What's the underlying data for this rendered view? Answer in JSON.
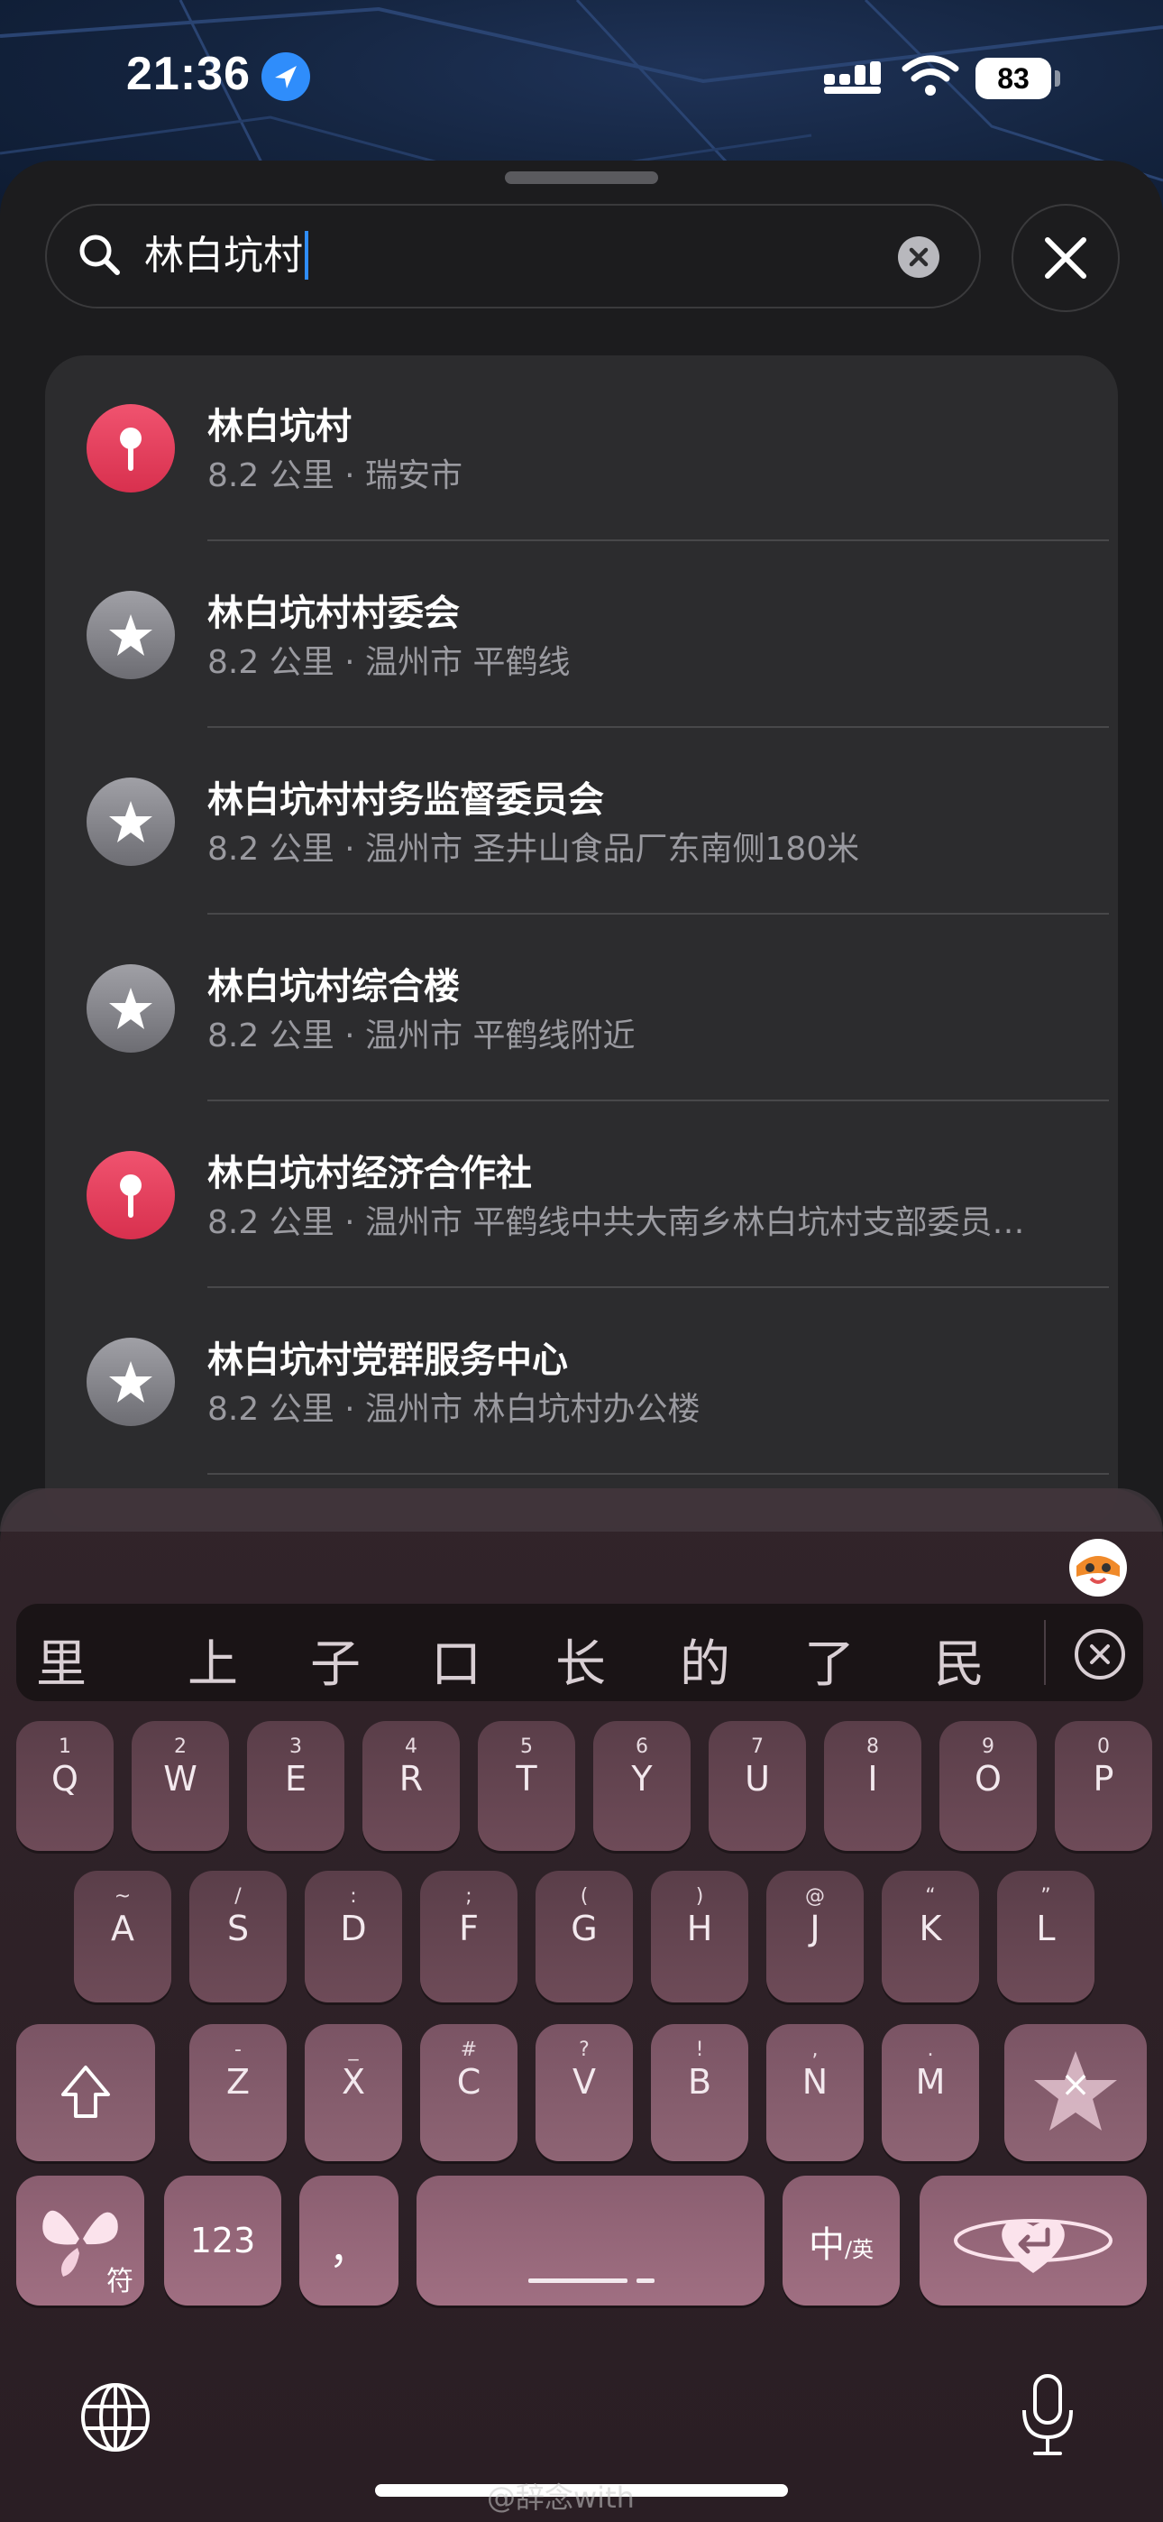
{
  "status_bar": {
    "time": "21:36",
    "battery": "83",
    "icons": [
      "location-arrow-icon",
      "cellular-signal-icon",
      "wifi-icon",
      "battery-icon"
    ]
  },
  "search": {
    "value": "林白坑村",
    "icons": [
      "search-icon",
      "clear-icon",
      "close-icon"
    ]
  },
  "results": [
    {
      "icon": "pin-icon",
      "title": "林白坑村",
      "subtitle": "8.2 公里 · 瑞安市"
    },
    {
      "icon": "star-icon",
      "title": "林白坑村村委会",
      "subtitle": "8.2 公里 · 温州市 平鹤线"
    },
    {
      "icon": "star-icon",
      "title": "林白坑村村务监督委员会",
      "subtitle": "8.2 公里 · 温州市 圣井山食品厂东南侧180米"
    },
    {
      "icon": "star-icon",
      "title": "林白坑村综合楼",
      "subtitle": "8.2 公里 · 温州市 平鹤线附近"
    },
    {
      "icon": "pin-icon",
      "title": "林白坑村经济合作社",
      "subtitle": "8.2 公里 · 温州市 平鹤线中共大南乡林白坑村支部委员…"
    },
    {
      "icon": "star-icon",
      "title": "林白坑村党群服务中心",
      "subtitle": "8.2 公里 · 温州市 林白坑村办公楼"
    }
  ],
  "keyboard": {
    "candidates": [
      "里",
      "上",
      "子",
      "口",
      "长",
      "的",
      "了",
      "民"
    ],
    "row1": [
      {
        "main": "Q",
        "sub": "1"
      },
      {
        "main": "W",
        "sub": "2"
      },
      {
        "main": "E",
        "sub": "3"
      },
      {
        "main": "R",
        "sub": "4"
      },
      {
        "main": "T",
        "sub": "5"
      },
      {
        "main": "Y",
        "sub": "6"
      },
      {
        "main": "U",
        "sub": "7"
      },
      {
        "main": "I",
        "sub": "8"
      },
      {
        "main": "O",
        "sub": "9"
      },
      {
        "main": "P",
        "sub": "0"
      }
    ],
    "row2": [
      {
        "main": "A",
        "sub": "~"
      },
      {
        "main": "S",
        "sub": "/"
      },
      {
        "main": "D",
        "sub": ":"
      },
      {
        "main": "F",
        "sub": ";"
      },
      {
        "main": "G",
        "sub": "("
      },
      {
        "main": "H",
        "sub": ")"
      },
      {
        "main": "J",
        "sub": "@"
      },
      {
        "main": "K",
        "sub": "“"
      },
      {
        "main": "L",
        "sub": "”"
      }
    ],
    "row3": [
      {
        "main": "Z",
        "sub": "-"
      },
      {
        "main": "X",
        "sub": "_"
      },
      {
        "main": "C",
        "sub": "#"
      },
      {
        "main": "V",
        "sub": "?"
      },
      {
        "main": "B",
        "sub": "!"
      },
      {
        "main": "N",
        "sub": ","
      },
      {
        "main": "M",
        "sub": "."
      }
    ],
    "symbol_label": "符",
    "numbers_label": "123",
    "comma_label": "，",
    "lang_label": "中",
    "lang_sub": "/英",
    "delete_label": "×"
  },
  "bottom": {
    "watermark": "@辞念with",
    "icons": [
      "globe-icon",
      "microphone-icon"
    ]
  }
}
